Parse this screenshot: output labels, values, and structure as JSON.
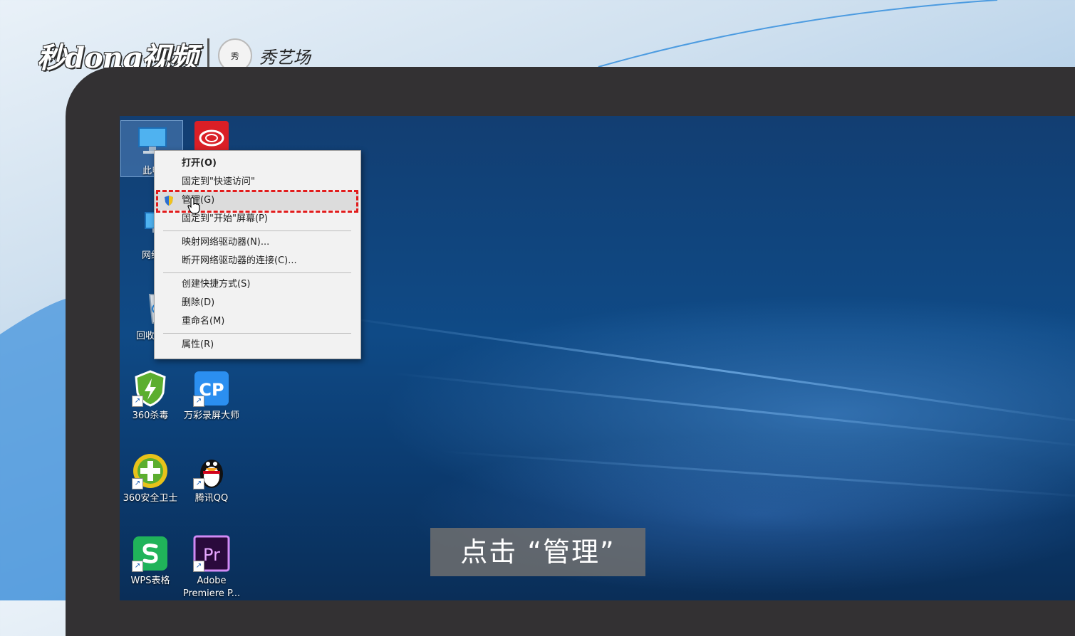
{
  "brand": {
    "logo_text": "秒dong视频",
    "seal_text": "秀",
    "partner_text": "秀艺场"
  },
  "desktop": {
    "icons": [
      {
        "id": "this-pc",
        "label": "此电",
        "icon": "computer-icon",
        "shortcut": false,
        "selected": true
      },
      {
        "id": "creative-cloud",
        "label": "",
        "icon": "creative-cloud-icon",
        "shortcut": false
      },
      {
        "id": "network",
        "label": "网络",
        "icon": "network-icon",
        "shortcut": false
      },
      {
        "id": "recycle-bin",
        "label": "回收",
        "icon": "recycle-bin-icon",
        "shortcut": false
      },
      {
        "id": "360-antivirus",
        "label": "360杀毒",
        "icon": "shield-lightning-icon",
        "shortcut": true
      },
      {
        "id": "wancai",
        "label": "万彩录屏大师",
        "icon": "cp-icon",
        "shortcut": true
      },
      {
        "id": "360-safe",
        "label": "360安全卫士",
        "icon": "plus-circle-icon",
        "shortcut": true
      },
      {
        "id": "qq",
        "label": "腾讯QQ",
        "icon": "penguin-icon",
        "shortcut": true
      },
      {
        "id": "wps",
        "label": "WPS表格",
        "icon": "wps-s-icon",
        "shortcut": true
      },
      {
        "id": "premiere",
        "label": "Adobe Premiere P...",
        "icon": "premiere-icon",
        "shortcut": true
      }
    ]
  },
  "context_menu": {
    "items": [
      {
        "label": "打开(O)",
        "bold": true
      },
      {
        "label": "固定到\"快速访问\""
      },
      {
        "label": "管理(G)",
        "hover": true,
        "icon": "uac-shield-icon"
      },
      {
        "label": "固定到\"开始\"屏幕(P)"
      },
      {
        "label": "映射网络驱动器(N)..."
      },
      {
        "label": "断开网络驱动器的连接(C)..."
      },
      {
        "label": "创建快捷方式(S)"
      },
      {
        "label": "删除(D)"
      },
      {
        "label": "重命名(M)"
      },
      {
        "label": "属性(R)"
      }
    ],
    "highlight_color": "#e21c1c"
  },
  "caption": {
    "text": "点击 “管理”"
  },
  "colors": {
    "monitor_bezel": "#333133",
    "desktop_blue": "#0f4a86",
    "menu_bg": "#f2f2f2"
  }
}
